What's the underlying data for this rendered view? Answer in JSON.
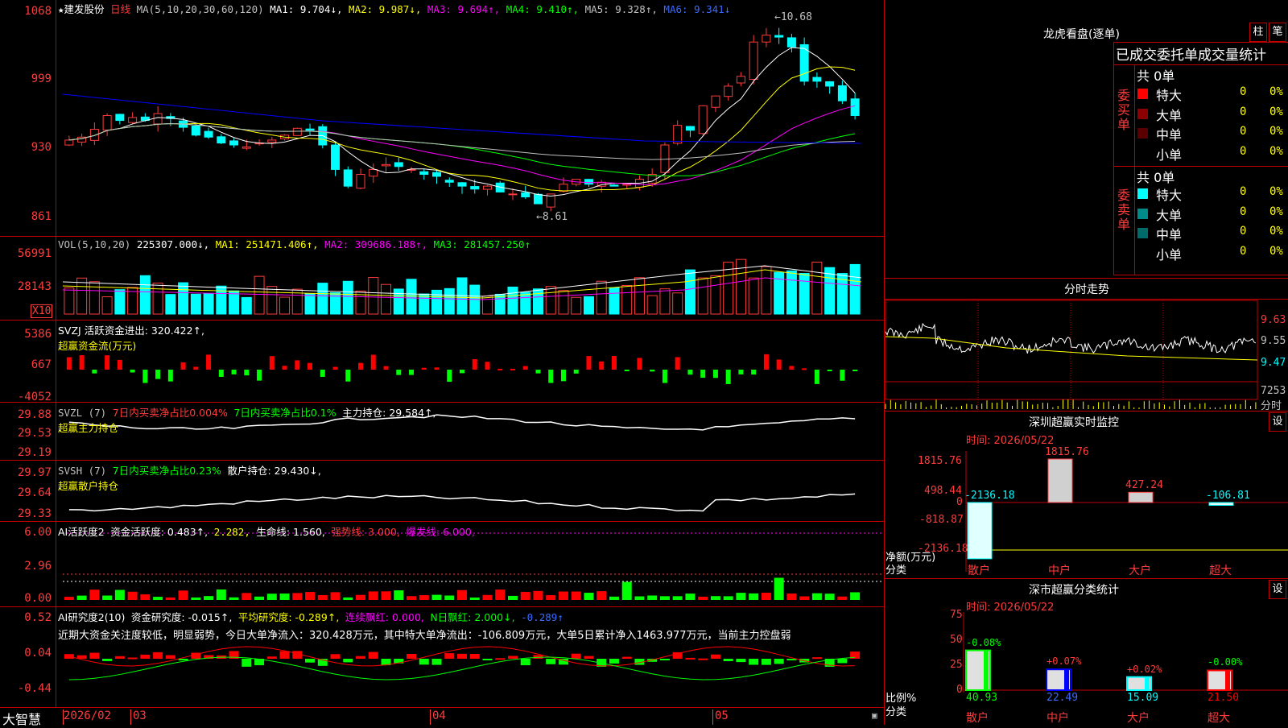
{
  "main": {
    "stock_star": "★",
    "stock_name": "建发股份",
    "period": "日线",
    "ma_params": "MA(5,10,20,30,60,120)",
    "ma1": "MA1: 9.704↓,",
    "ma2": "MA2: 9.987↓,",
    "ma3": "MA3: 9.694↑,",
    "ma4": "MA4: 9.410↑,",
    "ma5": "MA5: 9.328↑,",
    "ma6": "MA6: 9.341↓",
    "high_label": "10.68",
    "low_label": "8.61",
    "y_ticks": [
      "1068",
      "999",
      "930",
      "861"
    ]
  },
  "vol": {
    "title": "VOL(5,10,20)",
    "value": "225307.000↓,",
    "ma1": "MA1: 251471.406↑,",
    "ma2": "MA2: 309686.188↑,",
    "ma3": "MA3: 281457.250↑",
    "y_ticks": [
      "56991",
      "28143"
    ],
    "unit": "X10"
  },
  "svzj": {
    "title": "SVZJ  活跃资金进出: 320.422↑,",
    "subtitle": "超赢资金流(万元)",
    "y_ticks": [
      "5386",
      "667",
      "-4052"
    ]
  },
  "svzl": {
    "title": "SVZL (7)",
    "a": "7日内买卖净占比0.004%",
    "b": "7日内买卖净占比0.1%",
    "c": "主力持仓: 29.584↑,",
    "subtitle": "超赢主力持仓",
    "y_ticks": [
      "29.88",
      "29.53",
      "29.19"
    ]
  },
  "svsh": {
    "title": "SVSH (7)",
    "a": "7日内买卖净占比0.23%",
    "c": "散户持仓: 29.430↓,",
    "subtitle": "超赢散户持仓",
    "y_ticks": [
      "29.97",
      "29.64",
      "29.33"
    ]
  },
  "ai1": {
    "title": "AI活跃度2",
    "a": "资金活跃度: 0.483↑,",
    "b": "2.282,",
    "c": "生命线: 1.560,",
    "d": "强势线: 3.000,",
    "e": "爆发线: 6.000,",
    "y_ticks": [
      "6.00",
      "2.96",
      "0.00"
    ]
  },
  "ai2": {
    "title": "AI研究度2(10)",
    "a": "资金研究度: -0.015↑,",
    "b": "平均研究度: -0.289↑,",
    "c": "连续飘红: 0.000,",
    "d": "N日飘红: 2.000↓,",
    "e": "-0.289↑",
    "comment": "近期大资金关注度较低，明显弱势，今日大单净流入：320.428万元，其中特大单净流出：-106.809万元，大单5日累计净入1463.977万元，当前主力控盘弱",
    "y_ticks": [
      "0.52",
      "0.04",
      "-0.44"
    ]
  },
  "dates": {
    "brand": "大智慧",
    "d1": "2026/02",
    "d2": "03",
    "d3": "04",
    "d4": "05"
  },
  "right": {
    "dragon_title": "龙虎看盘(逐单)",
    "btn1": "柱",
    "btn2": "笔",
    "tabs": "已成交委托单成交量统计",
    "buy_total": "共 0单",
    "sell_total": "共 0单",
    "buy_label": "委买单",
    "sell_label": "委卖单",
    "buy_rows": [
      {
        "name": "特大",
        "count": "0",
        "pct": "0%",
        "color": "#ff0000"
      },
      {
        "name": "大单",
        "count": "0",
        "pct": "0%",
        "color": "#8b0000"
      },
      {
        "name": "中单",
        "count": "0",
        "pct": "0%",
        "color": "#5a0000"
      },
      {
        "name": "小单",
        "count": "0",
        "pct": "0%",
        "color": "#000000"
      }
    ],
    "sell_rows": [
      {
        "name": "特大",
        "count": "0",
        "pct": "0%",
        "color": "#00ffff"
      },
      {
        "name": "大单",
        "count": "0",
        "pct": "0%",
        "color": "#008b8b"
      },
      {
        "name": "中单",
        "count": "0",
        "pct": "0%",
        "color": "#006b6b"
      },
      {
        "name": "小单",
        "count": "0",
        "pct": "0%",
        "color": "#000000"
      }
    ],
    "fenshi_title": "分时走势",
    "fenshi_ticks": [
      "9.63",
      "9.55",
      "9.47"
    ],
    "fenshi_vol": "7253",
    "fenshi_label": "分时",
    "monitor_title": "深圳超赢实时监控",
    "monitor_set": "设",
    "monitor_time": "时间: 2026/05/22",
    "monitor_ticks": [
      "1815.76",
      "498.44",
      "0",
      "-818.87",
      "-2136.18"
    ],
    "monitor_bars": [
      {
        "label": "散户",
        "value": "-2136.18"
      },
      {
        "label": "中户",
        "value": "1815.76"
      },
      {
        "label": "大户",
        "value": "427.24"
      },
      {
        "label": "超大",
        "value": "-106.81"
      }
    ],
    "monitor_axis_name": "净额(万元)",
    "monitor_axis_cat": "分类",
    "stat_title": "深市超赢分类统计",
    "stat_set": "设",
    "stat_time": "时间: 2026/05/22",
    "stat_ticks": [
      "75",
      "50",
      "25",
      "0"
    ],
    "stat_bars": [
      {
        "label": "散户",
        "value": "40.93",
        "delta": "-0.08%"
      },
      {
        "label": "中户",
        "value": "22.49",
        "delta": "+0.07%"
      },
      {
        "label": "大户",
        "value": "15.09",
        "delta": "+0.02%"
      },
      {
        "label": "超大",
        "value": "21.50",
        "delta": "-0.00%"
      }
    ],
    "stat_axis_name": "比例%",
    "stat_axis_cat": "分类"
  },
  "colors": {
    "up": "#ff3b3b",
    "down": "#00ffff",
    "ma1": "#ffffff",
    "ma2": "#ffff00",
    "ma3": "#ff00ff",
    "ma4": "#00ff00",
    "ma5": "#c0c0c0",
    "ma6": "#0000ff"
  }
}
